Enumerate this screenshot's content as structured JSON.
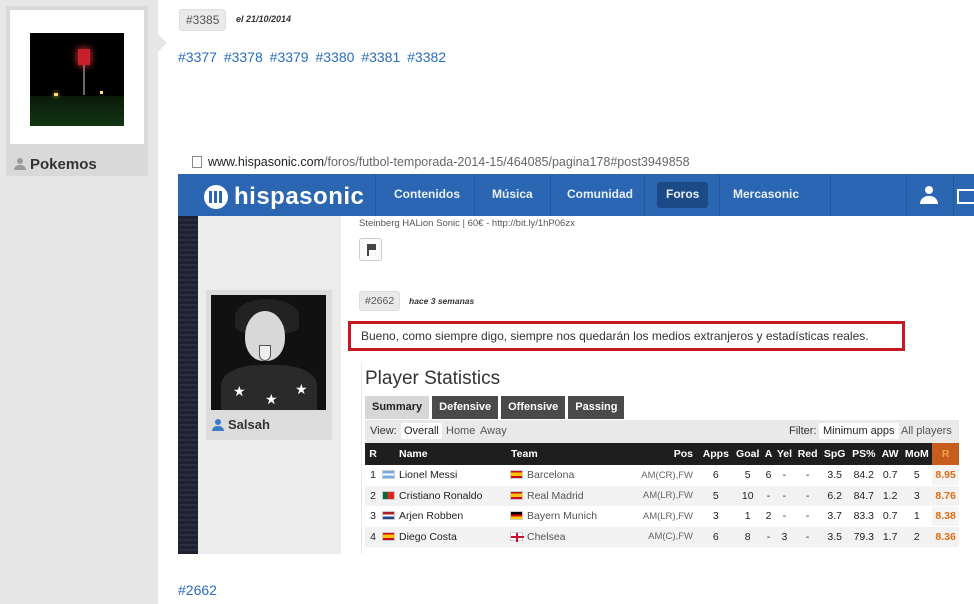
{
  "user": {
    "name": "Pokemos",
    "avatar_icon": "night-diner-photo"
  },
  "post": {
    "number": "#3385",
    "date": "el 21/10/2014",
    "refs": [
      "#3377",
      "#3378",
      "#3379",
      "#3380",
      "#3381",
      "#3382"
    ],
    "bottom_ref": "#2662"
  },
  "screenshot": {
    "url_host": "www.hispasonic.com",
    "url_path": "/foros/futbol-temporada-2014-15/464085/pagina178#post3949858",
    "logo": "hispasonic",
    "nav": [
      "Contenidos",
      "Música",
      "Comunidad",
      "Foros",
      "Mercasonic"
    ],
    "nav_active": "Foros",
    "signature": "Steinberg HALion Sonic | 60€ - http://bit.ly/1hP06zx",
    "inner_user": "Salsah",
    "inner_post_number": "#2662",
    "inner_post_date": "hace 3 semanas",
    "quote": "Bueno, como siempre digo, siempre nos quedarán los medios extranjeros y estadísticas reales.",
    "stats": {
      "title": "Player Statistics",
      "tabs": [
        "Summary",
        "Defensive",
        "Offensive",
        "Passing"
      ],
      "view_label": "View:",
      "view_options": [
        "Overall",
        "Home",
        "Away"
      ],
      "filter_label": "Filter:",
      "filter_options": [
        "Minimum apps",
        "All players"
      ],
      "columns": [
        "R",
        "Name",
        "Team",
        "Pos",
        "Apps",
        "Goal",
        "A",
        "Yel",
        "Red",
        "SpG",
        "PS%",
        "AW",
        "MoM",
        "R"
      ],
      "rows": [
        {
          "r": "1",
          "name": "Lionel Messi",
          "flag": "ar",
          "team": "Barcelona",
          "team_flag": "es",
          "pos": "AM(CR),FW",
          "apps": "6",
          "goal": "5",
          "a": "6",
          "yel": "-",
          "red": "-",
          "spg": "3.5",
          "ps": "84.2",
          "aw": "0.7",
          "mom": "5",
          "rating": "8.95"
        },
        {
          "r": "2",
          "name": "Cristiano Ronaldo",
          "flag": "pt",
          "team": "Real Madrid",
          "team_flag": "es",
          "pos": "AM(LR),FW",
          "apps": "5",
          "goal": "10",
          "a": "-",
          "yel": "-",
          "red": "-",
          "spg": "6.2",
          "ps": "84.7",
          "aw": "1.2",
          "mom": "3",
          "rating": "8.76"
        },
        {
          "r": "3",
          "name": "Arjen Robben",
          "flag": "nl",
          "team": "Bayern Munich",
          "team_flag": "de",
          "pos": "AM(LR),FW",
          "apps": "3",
          "goal": "1",
          "a": "2",
          "yel": "-",
          "red": "-",
          "spg": "3.7",
          "ps": "83.3",
          "aw": "0.7",
          "mom": "1",
          "rating": "8.38"
        },
        {
          "r": "4",
          "name": "Diego Costa",
          "flag": "es",
          "team": "Chelsea",
          "team_flag": "en",
          "pos": "AM(C),FW",
          "apps": "6",
          "goal": "8",
          "a": "-",
          "yel": "3",
          "red": "-",
          "spg": "3.5",
          "ps": "79.3",
          "aw": "1.7",
          "mom": "2",
          "rating": "8.36"
        }
      ]
    }
  }
}
